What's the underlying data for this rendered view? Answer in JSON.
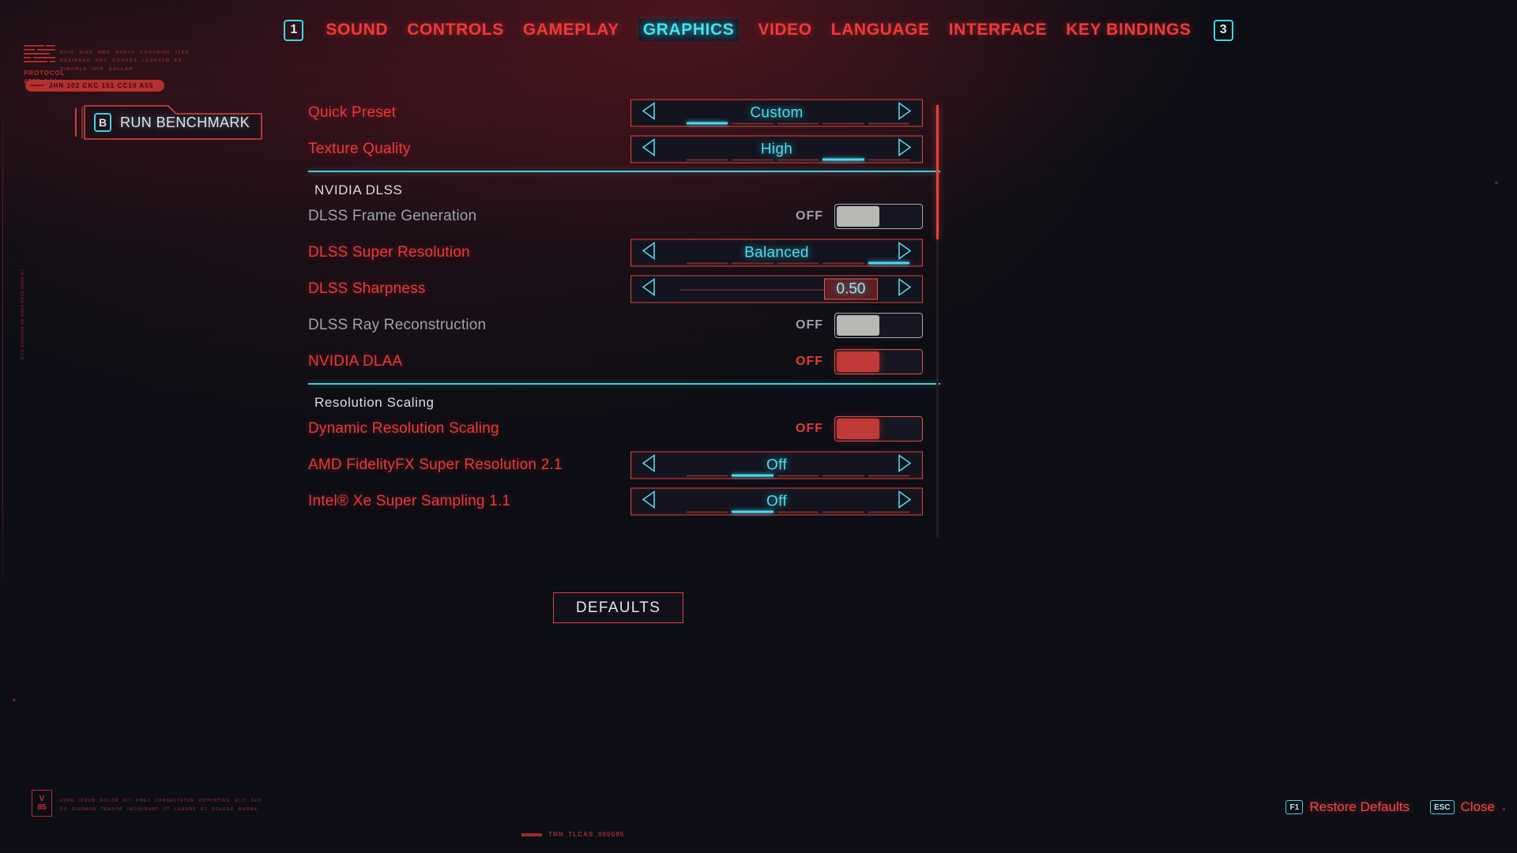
{
  "nav": {
    "left_badge": "1",
    "right_badge": "3",
    "items": [
      {
        "label": "SOUND",
        "active": false
      },
      {
        "label": "CONTROLS",
        "active": false
      },
      {
        "label": "GAMEPLAY",
        "active": false
      },
      {
        "label": "GRAPHICS",
        "active": true
      },
      {
        "label": "VIDEO",
        "active": false
      },
      {
        "label": "LANGUAGE",
        "active": false
      },
      {
        "label": "INTERFACE",
        "active": false
      },
      {
        "label": "KEY BINDINGS",
        "active": false
      }
    ]
  },
  "decor": {
    "protocol_line1": "PROTOCOL",
    "protocol_line2": "4520-A44",
    "lorem": "DUIS SINE AWE ARETU CONTHINE ITER DESIGNER NEC DOORES LASRATO EX DIMORLE IPIS DOLLAR",
    "tag": "JHN 102 CKC 151 CC10 A55",
    "ruler_text": "SYS 0000000 08 0000 0010 0000 AT",
    "bottom_code": "LORE IPSUM DOLOR SIT AMET CONSECTETUR ADIPISCING ELIT SED DO EIUSMOD TEMPOR INCIDIDUNT UT LABORE ET DOLORE MAGNA",
    "version_v": "V",
    "version_num": "85",
    "serial": "TRN_TLCAS_000095"
  },
  "run_benchmark": {
    "key": "B",
    "label": "RUN BENCHMARK"
  },
  "settings": {
    "rows": [
      {
        "kind": "spinner",
        "name": "quick-preset",
        "label": "Quick Preset",
        "enabled": true,
        "value": "Custom",
        "tick_count": 5,
        "tick_index": 0
      },
      {
        "kind": "spinner",
        "name": "texture-quality",
        "label": "Texture Quality",
        "enabled": true,
        "value": "High",
        "tick_count": 5,
        "tick_index": 3
      },
      {
        "kind": "section",
        "name": "nvidia-dlss",
        "title": "NVIDIA DLSS"
      },
      {
        "kind": "toggle",
        "name": "dlss-frame-generation",
        "label": "DLSS Frame Generation",
        "enabled": false,
        "state_label": "OFF",
        "on": false
      },
      {
        "kind": "spinner",
        "name": "dlss-super-resolution",
        "label": "DLSS Super Resolution",
        "enabled": true,
        "value": "Balanced",
        "tick_count": 5,
        "tick_index": 4
      },
      {
        "kind": "slider",
        "name": "dlss-sharpness",
        "label": "DLSS Sharpness",
        "enabled": true,
        "value": "0.50"
      },
      {
        "kind": "toggle",
        "name": "dlss-ray-reconstruction",
        "label": "DLSS Ray Reconstruction",
        "enabled": false,
        "state_label": "OFF",
        "on": false
      },
      {
        "kind": "toggle",
        "name": "nvidia-dlaa",
        "label": "NVIDIA DLAA",
        "enabled": true,
        "state_label": "OFF",
        "on": true
      },
      {
        "kind": "section",
        "name": "resolution-scaling",
        "title": "Resolution Scaling"
      },
      {
        "kind": "toggle",
        "name": "dynamic-resolution-scaling",
        "label": "Dynamic Resolution Scaling",
        "enabled": true,
        "state_label": "OFF",
        "on": true
      },
      {
        "kind": "spinner",
        "name": "amd-fidelityfx-super-resolution",
        "label": "AMD FidelityFX Super Resolution 2.1",
        "enabled": true,
        "value": "Off",
        "tick_count": 5,
        "tick_index": 1
      },
      {
        "kind": "spinner",
        "name": "intel-xe-super-sampling",
        "label": "Intel® Xe Super Sampling 1.1",
        "enabled": true,
        "value": "Off",
        "tick_count": 5,
        "tick_index": 1
      }
    ]
  },
  "defaults_button": {
    "label": "DEFAULTS"
  },
  "footer_hints": [
    {
      "key": "F1",
      "label": "Restore Defaults"
    },
    {
      "key": "ESC",
      "label": "Close"
    }
  ],
  "colors": {
    "red": "#e83a3a",
    "cyan": "#48dff0",
    "disabled": "#9fa2ad",
    "bg": "#0c0d14"
  }
}
